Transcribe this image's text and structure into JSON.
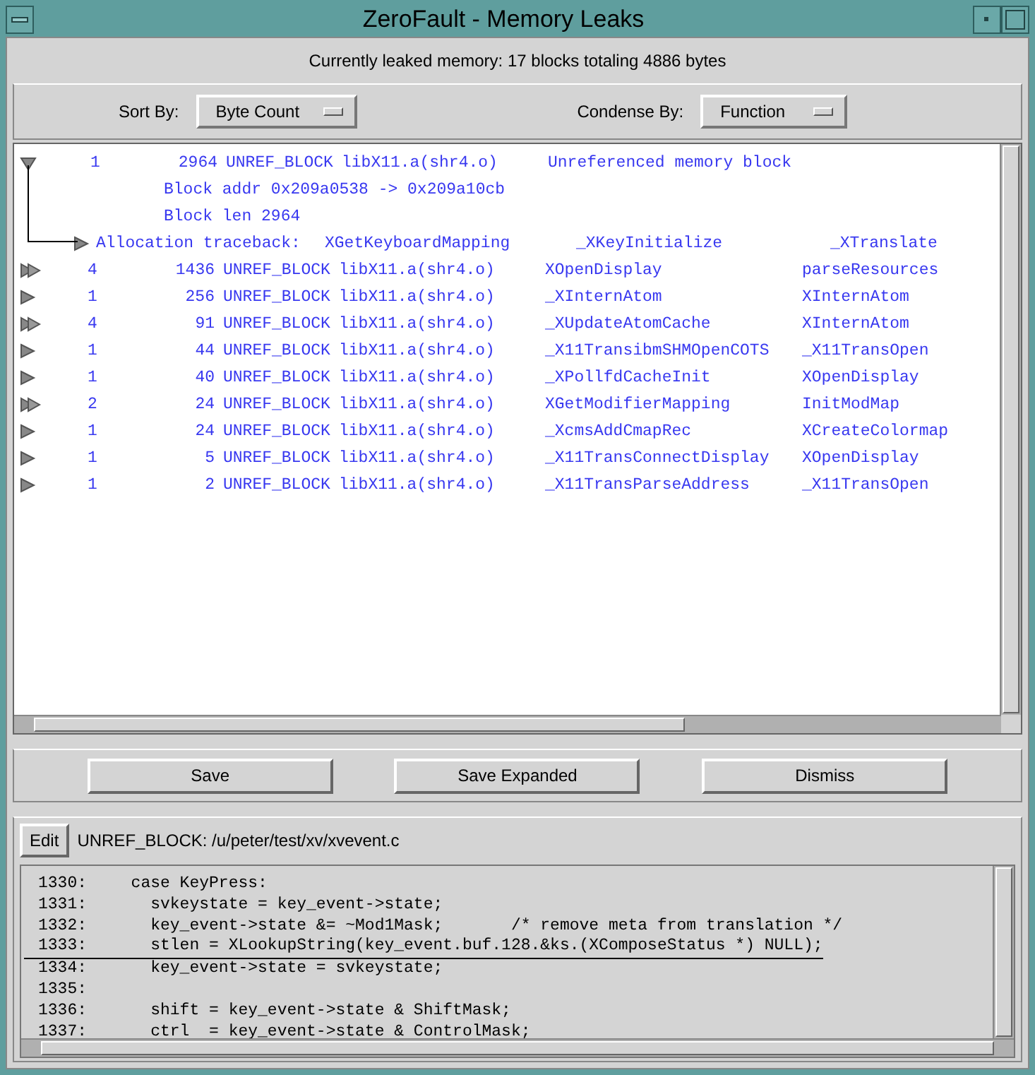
{
  "window": {
    "title": "ZeroFault - Memory Leaks"
  },
  "summary": "Currently leaked memory: 17 blocks totaling 4886 bytes",
  "sort_by": {
    "label": "Sort By:",
    "value": "Byte Count"
  },
  "condense_by": {
    "label": "Condense By:",
    "value": "Function"
  },
  "leaks": [
    {
      "kind": "single",
      "expanded": true,
      "count": "1",
      "bytes": "2964",
      "type": "UNREF_BLOCK",
      "library": "libX11.a(shr4.o)",
      "function_1": "Unreferenced memory block",
      "details": [
        {
          "kind": "text",
          "text": "Block addr 0x209a0538 -> 0x209a10cb"
        },
        {
          "kind": "text",
          "text": "Block len 2964"
        },
        {
          "kind": "traceback",
          "text": "Allocation traceback:",
          "frames": [
            "XGetKeyboardMapping",
            "_XKeyInitialize",
            "_XTranslate"
          ]
        }
      ]
    },
    {
      "kind": "multi",
      "expanded": false,
      "count": "4",
      "bytes": "1436",
      "type": "UNREF_BLOCK",
      "library": "libX11.a(shr4.o)",
      "function_1": "XOpenDisplay",
      "function_2": "parseResources"
    },
    {
      "kind": "single",
      "expanded": false,
      "count": "1",
      "bytes": "256",
      "type": "UNREF_BLOCK",
      "library": "libX11.a(shr4.o)",
      "function_1": "_XInternAtom",
      "function_2": "XInternAtom"
    },
    {
      "kind": "multi",
      "expanded": false,
      "count": "4",
      "bytes": "91",
      "type": "UNREF_BLOCK",
      "library": "libX11.a(shr4.o)",
      "function_1": "_XUpdateAtomCache",
      "function_2": "XInternAtom"
    },
    {
      "kind": "single",
      "expanded": false,
      "count": "1",
      "bytes": "44",
      "type": "UNREF_BLOCK",
      "library": "libX11.a(shr4.o)",
      "function_1": "_X11TransibmSHMOpenCOTS",
      "function_2": "_X11TransOpen"
    },
    {
      "kind": "single",
      "expanded": false,
      "count": "1",
      "bytes": "40",
      "type": "UNREF_BLOCK",
      "library": "libX11.a(shr4.o)",
      "function_1": "_XPollfdCacheInit",
      "function_2": "XOpenDisplay"
    },
    {
      "kind": "multi",
      "expanded": false,
      "count": "2",
      "bytes": "24",
      "type": "UNREF_BLOCK",
      "library": "libX11.a(shr4.o)",
      "function_1": "XGetModifierMapping",
      "function_2": "InitModMap"
    },
    {
      "kind": "single",
      "expanded": false,
      "count": "1",
      "bytes": "24",
      "type": "UNREF_BLOCK",
      "library": "libX11.a(shr4.o)",
      "function_1": "_XcmsAddCmapRec",
      "function_2": "XCreateColormap"
    },
    {
      "kind": "single",
      "expanded": false,
      "count": "1",
      "bytes": "5",
      "type": "UNREF_BLOCK",
      "library": "libX11.a(shr4.o)",
      "function_1": "_X11TransConnectDisplay",
      "function_2": "XOpenDisplay"
    },
    {
      "kind": "single",
      "expanded": false,
      "count": "1",
      "bytes": "2",
      "type": "UNREF_BLOCK",
      "library": "libX11.a(shr4.o)",
      "function_1": "_X11TransParseAddress",
      "function_2": "_X11TransOpen"
    }
  ],
  "buttons": [
    "Save",
    "Save Expanded",
    "Dismiss"
  ],
  "source": {
    "edit_button": "Edit",
    "location": "UNREF_BLOCK: /u/peter/test/xv/xvevent.c",
    "lines": [
      {
        "number": "1330:",
        "code": "  case KeyPress:",
        "current": false
      },
      {
        "number": "1331:",
        "code": "    svkeystate = key_event->state;",
        "current": false
      },
      {
        "number": "1332:",
        "code": "    key_event->state &= ~Mod1Mask;       /* remove meta from translation */",
        "current": false
      },
      {
        "number": "1333:",
        "code": "    stlen = XLookupString(key_event.buf.128.&ks.(XComposeStatus *) NULL);",
        "current": true
      },
      {
        "number": "1334:",
        "code": "    key_event->state = svkeystate;",
        "current": false
      },
      {
        "number": "1335:",
        "current": false
      },
      {
        "number": "1336:",
        "code": "    shift = key_event->state & ShiftMask;",
        "current": false
      },
      {
        "number": "1337:",
        "code": "    ctrl  = key_event->state & ControlMask;",
        "current": false
      }
    ]
  }
}
